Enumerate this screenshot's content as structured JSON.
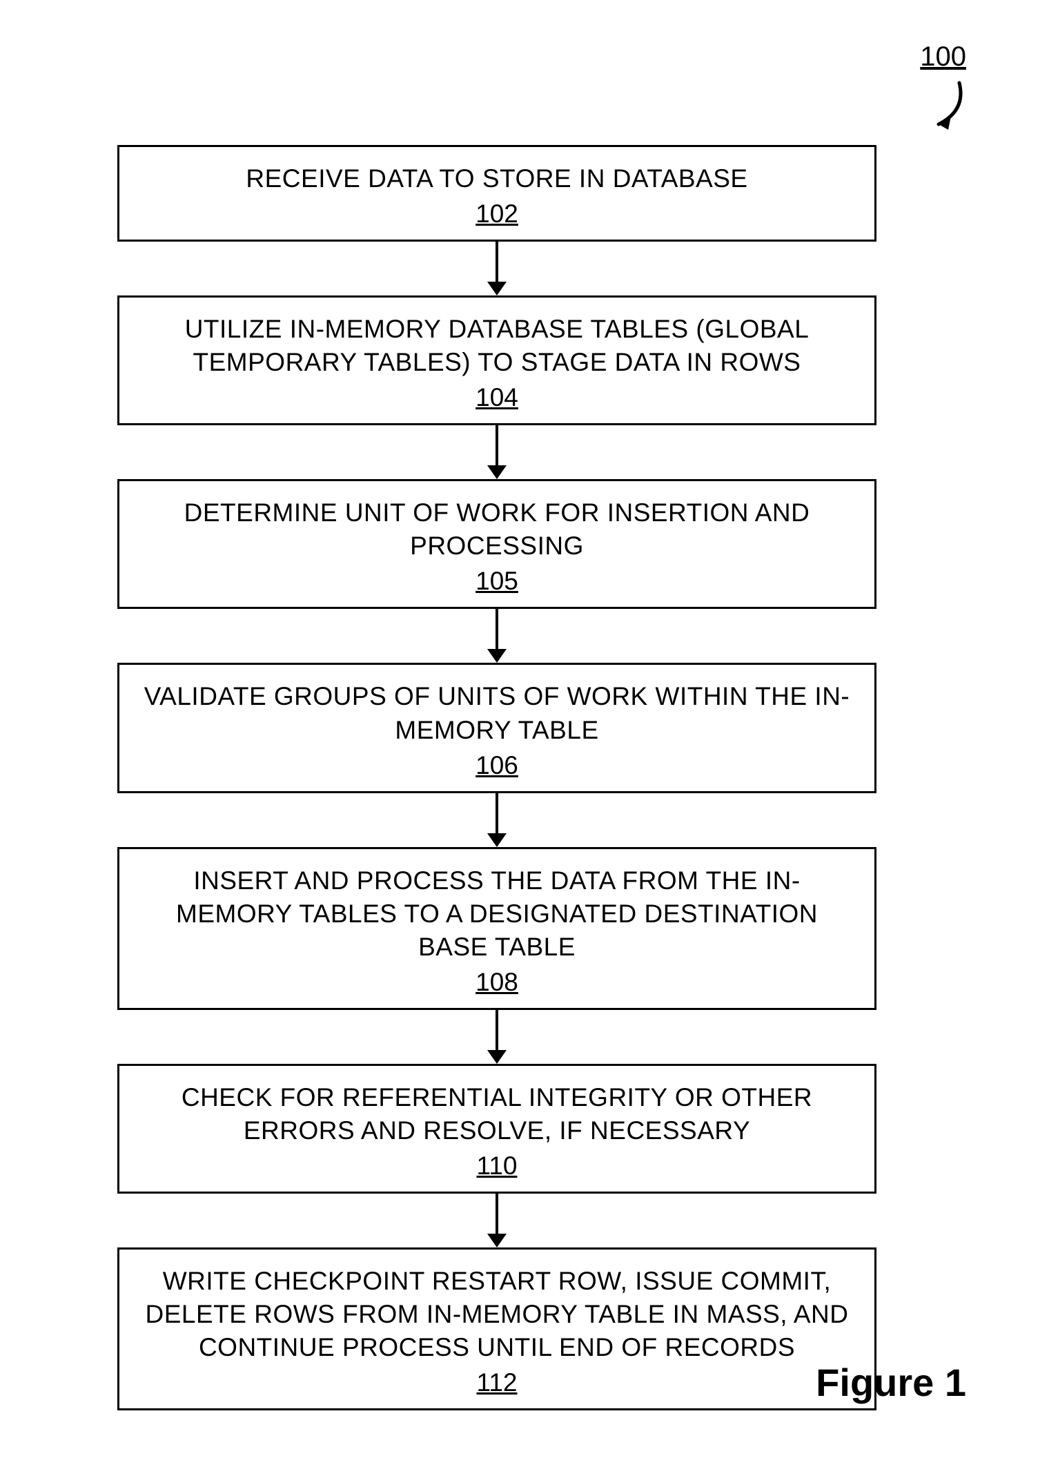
{
  "diagram": {
    "label": "100",
    "caption": "Figure 1",
    "steps": [
      {
        "text": "RECEIVE DATA TO STORE IN DATABASE",
        "ref": "102"
      },
      {
        "text": "UTILIZE IN-MEMORY DATABASE TABLES (GLOBAL TEMPORARY TABLES) TO STAGE DATA IN ROWS",
        "ref": "104"
      },
      {
        "text": "DETERMINE UNIT OF WORK FOR INSERTION AND PROCESSING",
        "ref": "105"
      },
      {
        "text": "VALIDATE GROUPS OF UNITS OF WORK WITHIN THE IN-MEMORY TABLE",
        "ref": "106"
      },
      {
        "text": "INSERT AND PROCESS THE DATA FROM THE IN-MEMORY TABLES TO A DESIGNATED DESTINATION BASE TABLE",
        "ref": "108"
      },
      {
        "text": "CHECK FOR REFERENTIAL INTEGRITY OR OTHER ERRORS AND RESOLVE, IF NECESSARY",
        "ref": "110"
      },
      {
        "text": "WRITE CHECKPOINT RESTART ROW, ISSUE COMMIT, DELETE ROWS FROM IN-MEMORY TABLE IN MASS, AND CONTINUE PROCESS UNTIL END OF RECORDS",
        "ref": "112"
      }
    ]
  }
}
